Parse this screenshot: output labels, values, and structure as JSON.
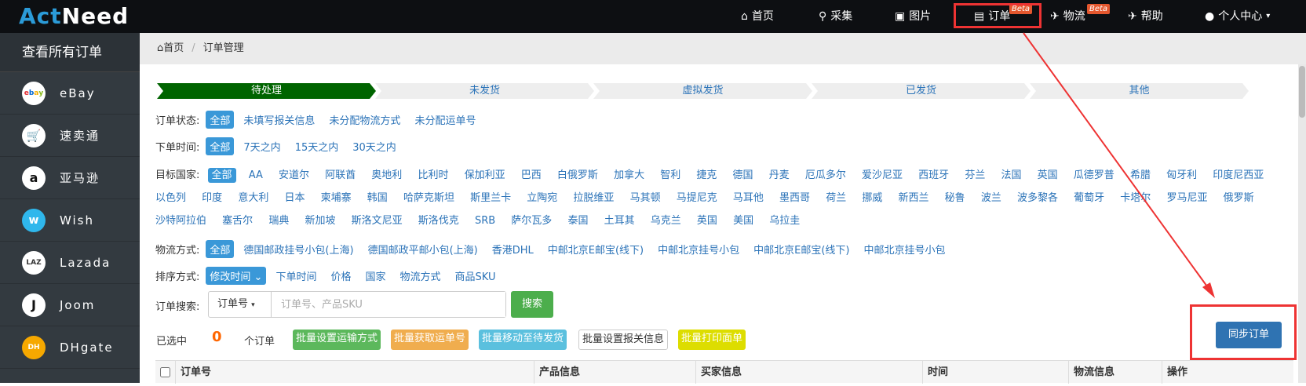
{
  "brand": {
    "part1": "Act",
    "part2": "Need"
  },
  "topnav": [
    {
      "icon": "home-icon",
      "glyph": "⌂",
      "label": "首页"
    },
    {
      "icon": "search-icon",
      "glyph": "🔍",
      "label": "采集"
    },
    {
      "icon": "picture-icon",
      "glyph": "▣",
      "label": "图片"
    },
    {
      "icon": "list-icon",
      "glyph": "▤",
      "label": "订单",
      "badge": "Beta"
    },
    {
      "icon": "plane-icon",
      "glyph": "✈",
      "label": "物流",
      "badge": "Beta"
    },
    {
      "icon": "plane-icon",
      "glyph": "✈",
      "label": "帮助"
    },
    {
      "icon": "user-icon",
      "glyph": "👤",
      "label": "个人中心"
    }
  ],
  "sidebar": {
    "title": "查看所有订单",
    "items": [
      {
        "label": "eBay",
        "logo": "ebay"
      },
      {
        "label": "速卖通",
        "logo": "🛒"
      },
      {
        "label": "亚马逊",
        "logo": "a"
      },
      {
        "label": "Wish",
        "logo": "W"
      },
      {
        "label": "Lazada",
        "logo": "LAZ"
      },
      {
        "label": "Joom",
        "logo": "J"
      },
      {
        "label": "DHgate",
        "logo": "DH"
      }
    ]
  },
  "breadcrumb": {
    "home": "首页",
    "current": "订单管理"
  },
  "steps": [
    "待处理",
    "未发货",
    "虚拟发货",
    "已发货",
    "其他"
  ],
  "filters": {
    "status": {
      "label": "订单状态:",
      "active": "全部",
      "options": [
        "未填写报关信息",
        "未分配物流方式",
        "未分配运单号"
      ]
    },
    "time": {
      "label": "下单时间:",
      "active": "全部",
      "options": [
        "7天之内",
        "15天之内",
        "30天之内"
      ]
    },
    "country": {
      "label": "目标国家:",
      "active": "全部",
      "options": [
        "AA",
        "安道尔",
        "阿联酋",
        "奥地利",
        "比利时",
        "保加利亚",
        "巴西",
        "白俄罗斯",
        "加拿大",
        "智利",
        "捷克",
        "德国",
        "丹麦",
        "厄瓜多尔",
        "爱沙尼亚",
        "西班牙",
        "芬兰",
        "法国",
        "英国",
        "瓜德罗普",
        "希腊",
        "匈牙利",
        "印度尼西亚",
        "以色列",
        "印度",
        "意大利",
        "日本",
        "柬埔寨",
        "韩国",
        "哈萨克斯坦",
        "斯里兰卡",
        "立陶宛",
        "拉脱维亚",
        "马其顿",
        "马提尼克",
        "马耳他",
        "墨西哥",
        "荷兰",
        "挪威",
        "新西兰",
        "秘鲁",
        "波兰",
        "波多黎各",
        "葡萄牙",
        "卡塔尔",
        "罗马尼亚",
        "俄罗斯",
        "沙特阿拉伯",
        "塞舌尔",
        "瑞典",
        "新加坡",
        "斯洛文尼亚",
        "斯洛伐克",
        "SRB",
        "萨尔瓦多",
        "泰国",
        "土耳其",
        "乌克兰",
        "英国",
        "美国",
        "乌拉圭"
      ]
    },
    "logistics": {
      "label": "物流方式:",
      "active": "全部",
      "options": [
        "德国邮政挂号小包(上海)",
        "德国邮政平邮小包(上海)",
        "香港DHL",
        "中邮北京E邮宝(线下)",
        "中邮北京挂号小包",
        "中邮北京E邮宝(线下)",
        "中邮北京挂号小包"
      ]
    },
    "sort": {
      "label": "排序方式:",
      "active": "修改时间",
      "options": [
        "下单时间",
        "价格",
        "国家",
        "物流方式",
        "商品SKU"
      ]
    }
  },
  "search": {
    "label": "订单搜索:",
    "select": "订单号",
    "placeholder": "订单号、产品SKU",
    "button": "搜索"
  },
  "selection": {
    "label": "已选中",
    "count": "0",
    "unit": "个订单"
  },
  "bulk_actions": [
    {
      "label": "批量设置运输方式",
      "color": "#5cb85c"
    },
    {
      "label": "批量获取运单号",
      "color": "#f0ad4e"
    },
    {
      "label": "批量移动至待发货",
      "color": "#5bc0de"
    },
    {
      "label": "批量设置报关信息",
      "color": "#ffffff"
    },
    {
      "label": "批量打印面单",
      "color": "#dddd00"
    }
  ],
  "sync_button": "同步订单",
  "table": {
    "columns": [
      "订单号",
      "产品信息",
      "买家信息",
      "时间",
      "物流信息",
      "操作"
    ]
  },
  "colors": {
    "accent": "#3a98d8",
    "active_step": "#006400",
    "highlight": "#ee3333"
  }
}
